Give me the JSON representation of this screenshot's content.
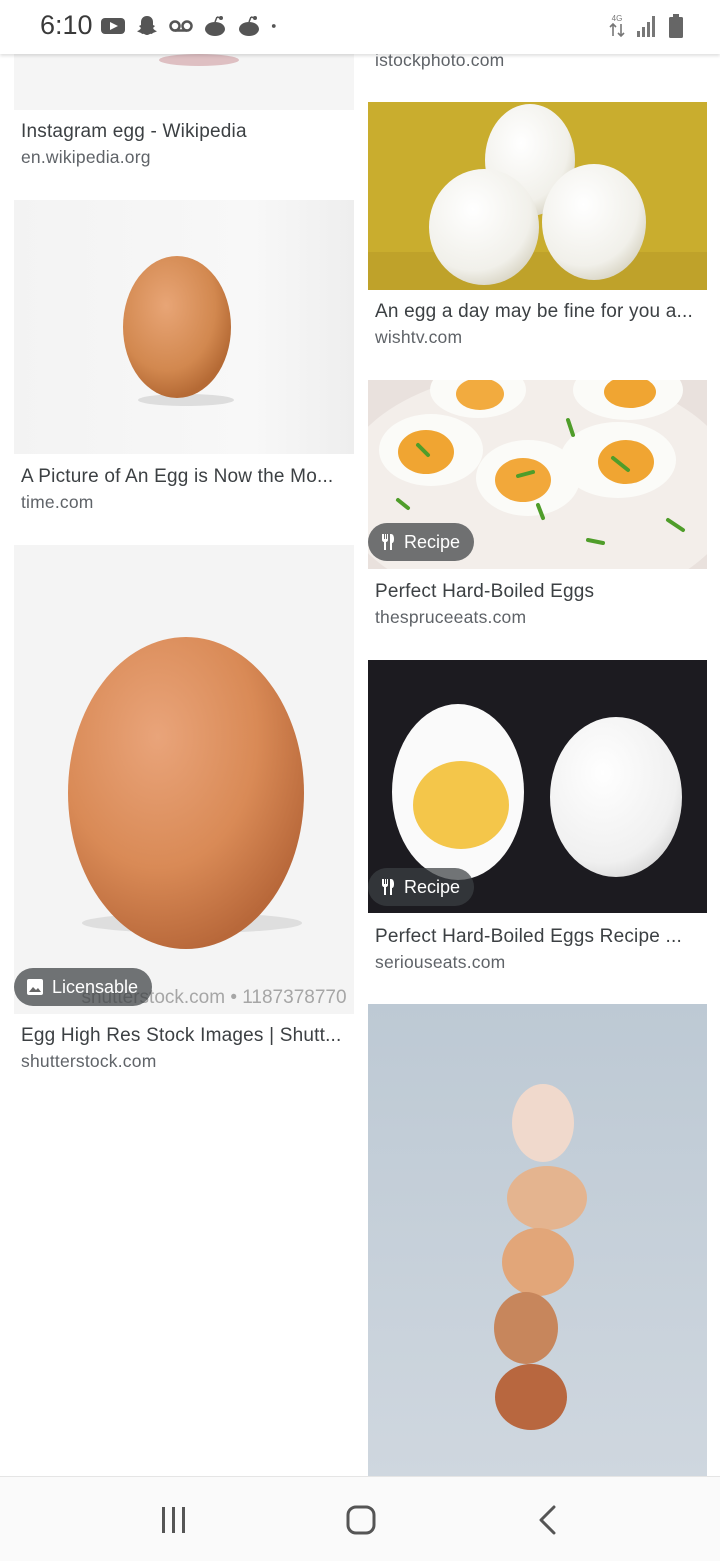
{
  "status_bar": {
    "time": "6:10",
    "left_icons": [
      "youtube-icon",
      "snapchat-icon",
      "voicemail-icon",
      "reddit-icon",
      "reddit-icon",
      "dot-icon"
    ],
    "network_label": "4G LTE",
    "right_icons": [
      "data-transfer-icon",
      "signal-icon",
      "battery-icon"
    ]
  },
  "top_partial_domain": "istockphoto.com",
  "results_left": [
    {
      "title": "Instagram egg - Wikipedia",
      "domain": "en.wikipedia.org"
    },
    {
      "title": "A Picture of An Egg is Now the Mo...",
      "domain": "time.com"
    },
    {
      "title": "Egg High Res Stock Images | Shutt...",
      "domain": "shutterstock.com",
      "badge": "Licensable",
      "watermark": "shutterstock.com • 1187378770"
    }
  ],
  "results_right": [
    {
      "title": "An egg a day may be fine for you a...",
      "domain": "wishtv.com"
    },
    {
      "title": "Perfect Hard-Boiled Eggs",
      "domain": "thespruceeats.com",
      "badge": "Recipe"
    },
    {
      "title": "Perfect Hard-Boiled Eggs Recipe ...",
      "domain": "seriouseats.com",
      "badge": "Recipe"
    }
  ],
  "nav_bar": {
    "recents": "recents-icon",
    "home": "home-icon",
    "back": "back-icon"
  }
}
